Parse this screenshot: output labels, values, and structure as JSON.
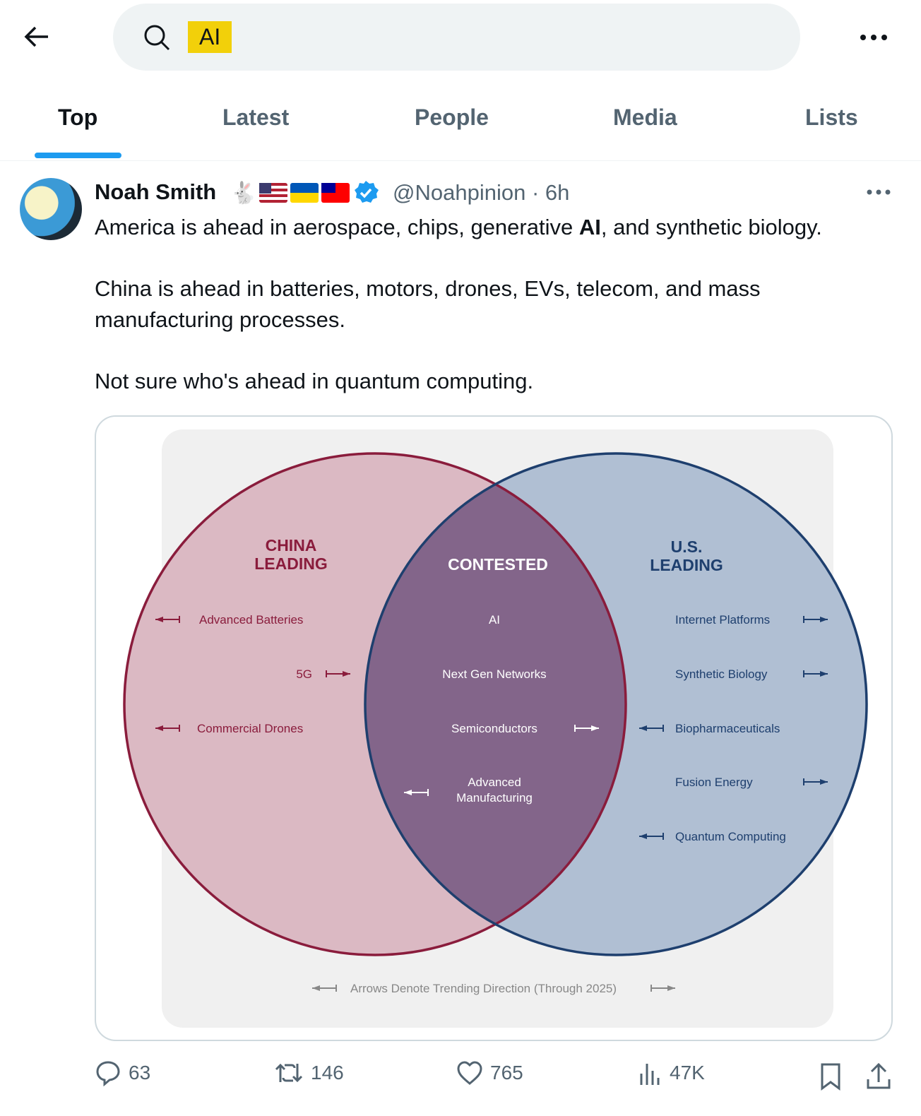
{
  "search": {
    "query": "AI"
  },
  "tabs": [
    {
      "label": "Top",
      "active": true
    },
    {
      "label": "Latest"
    },
    {
      "label": "People"
    },
    {
      "label": "Media"
    },
    {
      "label": "Lists"
    }
  ],
  "post": {
    "author": "Noah Smith",
    "emoji": "🐇",
    "handle": "@Noahpinion",
    "time": "· 6h",
    "text_1_pre": "America is ahead in aerospace, chips, generative ",
    "text_1_bold": "AI",
    "text_1_post": ", and synthetic biology.",
    "text_2": "China is ahead in batteries, motors, drones, EVs, telecom, and mass manufacturing processes.",
    "text_3": "Not sure who's ahead in quantum computing.",
    "stats": {
      "replies": "63",
      "reposts": "146",
      "likes": "765",
      "views": "47K"
    }
  },
  "venn": {
    "colors": {
      "china": "#dbb9c3",
      "china_stroke": "#8a1c3c",
      "us": "#b0bfd3",
      "us_stroke": "#1e3f6e",
      "contested": "#83658a"
    },
    "china_title": [
      "CHINA",
      "LEADING"
    ],
    "contested_title": "CONTESTED",
    "us_title": [
      "U.S.",
      "LEADING"
    ],
    "china_items": [
      {
        "label": "Advanced Batteries",
        "trend": "left"
      },
      {
        "label": "5G",
        "trend": "right"
      },
      {
        "label": "Commercial Drones",
        "trend": "left"
      }
    ],
    "contested_items": [
      {
        "label": "AI",
        "trend": "none"
      },
      {
        "label": "Next Gen Networks",
        "trend": "none"
      },
      {
        "label": "Semiconductors",
        "trend": "right"
      },
      {
        "label": "Advanced",
        "label2": "Manufacturing",
        "trend": "left"
      }
    ],
    "us_items": [
      {
        "label": "Internet Platforms",
        "trend": "right"
      },
      {
        "label": "Synthetic Biology",
        "trend": "right"
      },
      {
        "label": "Biopharmaceuticals",
        "trend": "left"
      },
      {
        "label": "Fusion Energy",
        "trend": "right"
      },
      {
        "label": "Quantum Computing",
        "trend": "left"
      }
    ],
    "footer": "Arrows Denote Trending Direction (Through 2025)"
  }
}
